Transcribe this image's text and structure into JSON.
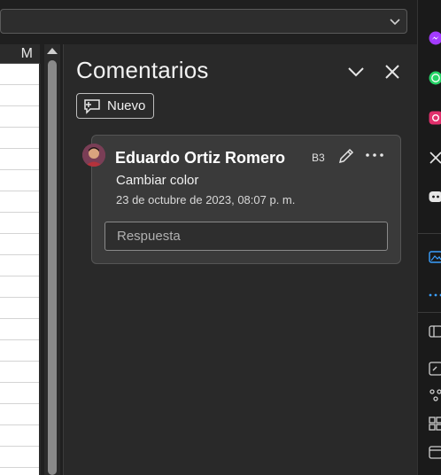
{
  "sheet": {
    "column_letter": "M"
  },
  "comments_pane": {
    "title": "Comentarios",
    "new_button_label": "Nuevo"
  },
  "comment": {
    "author": "Eduardo Ortiz Romero",
    "cell_ref": "B3",
    "text": "Cambiar color",
    "timestamp": "23 de octubre de 2023, 08:07 p. m.",
    "reply_placeholder": "Respuesta"
  },
  "rail": {
    "icons": [
      "messenger-icon",
      "whatsapp-icon",
      "instagram-icon",
      "x-icon",
      "discord-icon",
      "image-icon",
      "more-icon",
      "reader-icon",
      "capture-icon",
      "tree-icon",
      "apps-icon",
      "calendar-icon"
    ]
  },
  "colors": {
    "messenger": "#a33bff",
    "whatsapp": "#25d366",
    "instagram": "#e1306c",
    "discord": "#5865f2",
    "accent": "#3aa0ff"
  }
}
